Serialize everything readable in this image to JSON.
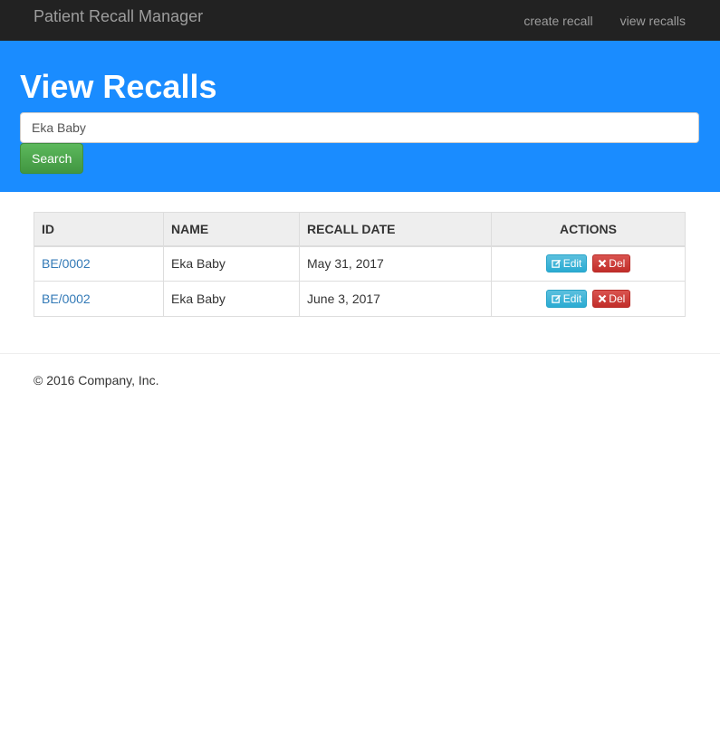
{
  "nav": {
    "brand": "Patient Recall Manager",
    "links": [
      "create recall",
      "view recalls"
    ]
  },
  "jumbotron": {
    "title": "View Recalls",
    "search_value": "Eka Baby",
    "search_button": "Search"
  },
  "table": {
    "headers": [
      "ID",
      "NAME",
      "RECALL DATE",
      "ACTIONS"
    ],
    "rows": [
      {
        "id": "BE/0002",
        "name": "Eka Baby",
        "date": "May 31, 2017",
        "edit": "Edit",
        "del": "Del"
      },
      {
        "id": "BE/0002",
        "name": "Eka Baby",
        "date": "June 3, 2017",
        "edit": "Edit",
        "del": "Del"
      }
    ]
  },
  "footer": {
    "text": "© 2016 Company, Inc."
  },
  "colors": {
    "navbar": "#222222",
    "jumbotron": "#1a8cff",
    "search_button": "#5cb85c",
    "edit_button": "#5bc0de",
    "delete_button": "#d9534f",
    "link": "#337ab7"
  },
  "icons": {
    "edit": "edit-icon",
    "delete": "times-icon"
  }
}
